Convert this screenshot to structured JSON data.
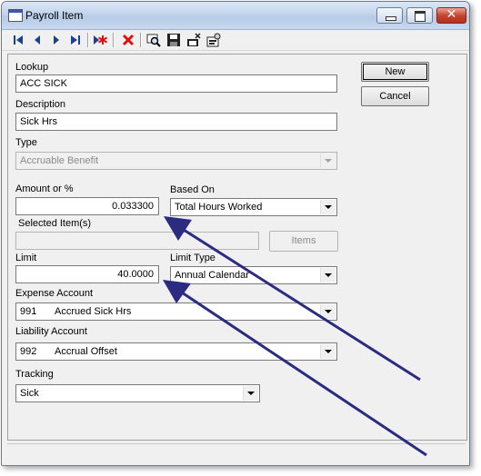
{
  "window": {
    "title": "Payroll Item",
    "close_glyph": "✕"
  },
  "toolbar": {
    "icons": [
      "first-record-icon",
      "previous-record-icon",
      "next-record-icon",
      "last-record-icon",
      "new-record-icon",
      "delete-icon",
      "find-icon",
      "save-icon",
      "print-icon",
      "properties-icon"
    ]
  },
  "form": {
    "lookup": {
      "label": "Lookup",
      "value": "ACC SICK"
    },
    "description": {
      "label": "Description",
      "value": "Sick Hrs"
    },
    "type": {
      "label": "Type",
      "value": "Accruable Benefit"
    },
    "amount": {
      "label": "Amount or %",
      "value": "0.033300"
    },
    "based_on": {
      "label": "Based On",
      "value": "Total Hours Worked"
    },
    "selected_items": {
      "label": "Selected Item(s)",
      "value": ""
    },
    "items_button": "Items",
    "limit": {
      "label": "Limit",
      "value": "40.0000"
    },
    "limit_type": {
      "label": "Limit Type",
      "value": "Annual Calendar"
    },
    "expense_account": {
      "label": "Expense Account",
      "code": "991",
      "name": "Accrued Sick Hrs"
    },
    "liability_account": {
      "label": "Liability Account",
      "code": "992",
      "name": "Accrual Offset"
    },
    "tracking": {
      "label": "Tracking",
      "value": "Sick"
    }
  },
  "buttons": {
    "new": "New",
    "cancel": "Cancel"
  },
  "colors": {
    "annotation_arrow": "#2b2b82",
    "titlebar": "#c3d5ec",
    "close_button": "#c7452f"
  }
}
